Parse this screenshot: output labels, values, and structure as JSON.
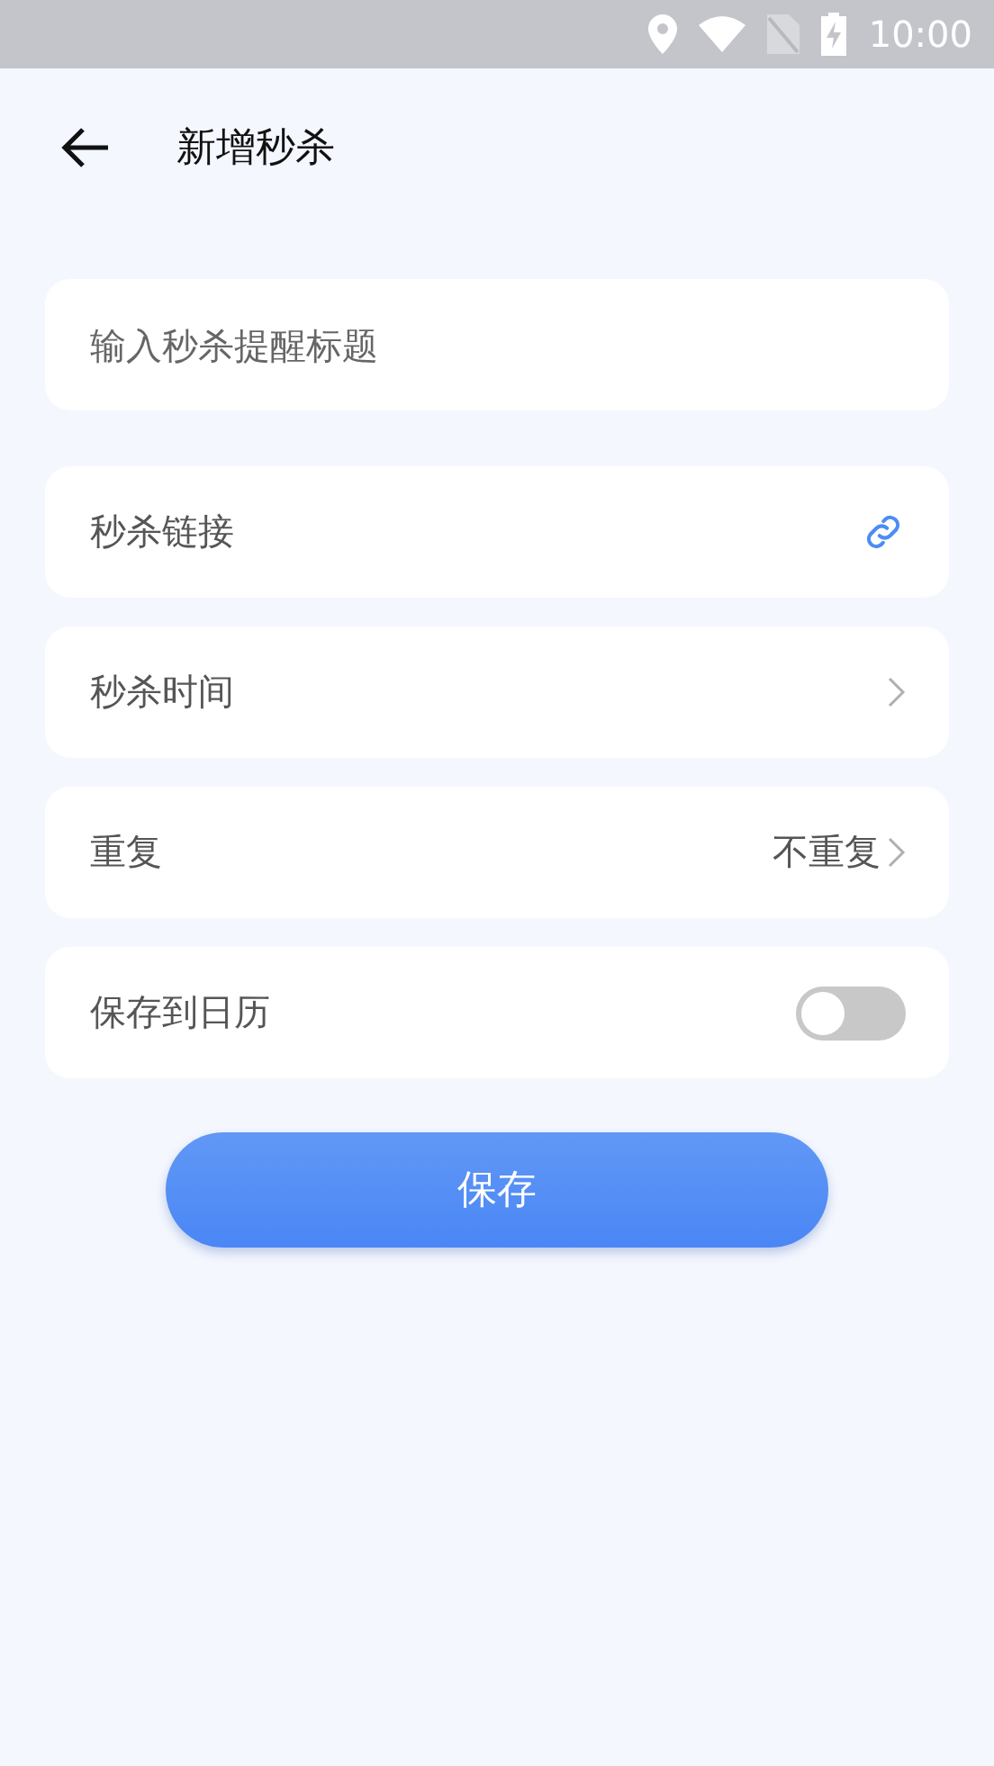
{
  "status_bar": {
    "time": "10:00"
  },
  "header": {
    "title": "新增秒杀"
  },
  "title_field": {
    "placeholder": "输入秒杀提醒标题"
  },
  "rows": [
    {
      "kind": "link",
      "label": "秒杀链接"
    },
    {
      "kind": "chevron",
      "label": "秒杀时间"
    },
    {
      "kind": "chevron",
      "label": "重复",
      "value": "不重复"
    },
    {
      "kind": "toggle",
      "label": "保存到日历",
      "on": false
    }
  ],
  "save_button": {
    "label": "保存"
  }
}
